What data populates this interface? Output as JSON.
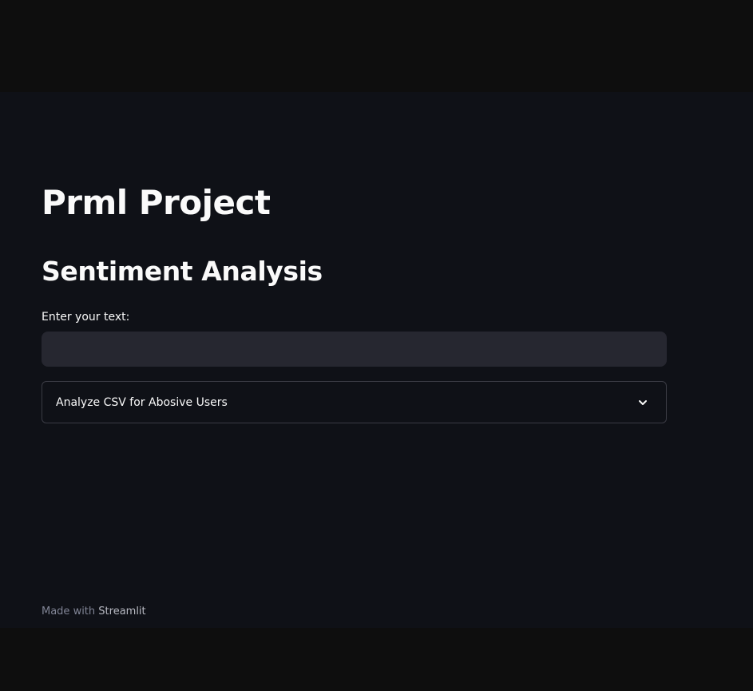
{
  "main": {
    "title": "Prml Project",
    "subheader": "Sentiment Analysis",
    "text_input": {
      "label": "Enter your text:",
      "value": "",
      "placeholder": ""
    },
    "expander": {
      "label": "Analyze CSV for Abosive Users",
      "icon": "chevron-down-icon"
    }
  },
  "footer": {
    "prefix": "Made with",
    "link": "Streamlit"
  },
  "colors": {
    "app_background": "#0f1117",
    "outer_background": "#0e0e0e",
    "text": "#fafafa",
    "input_background": "#262730",
    "border": "#3a3b44",
    "muted_text": "#808495"
  }
}
